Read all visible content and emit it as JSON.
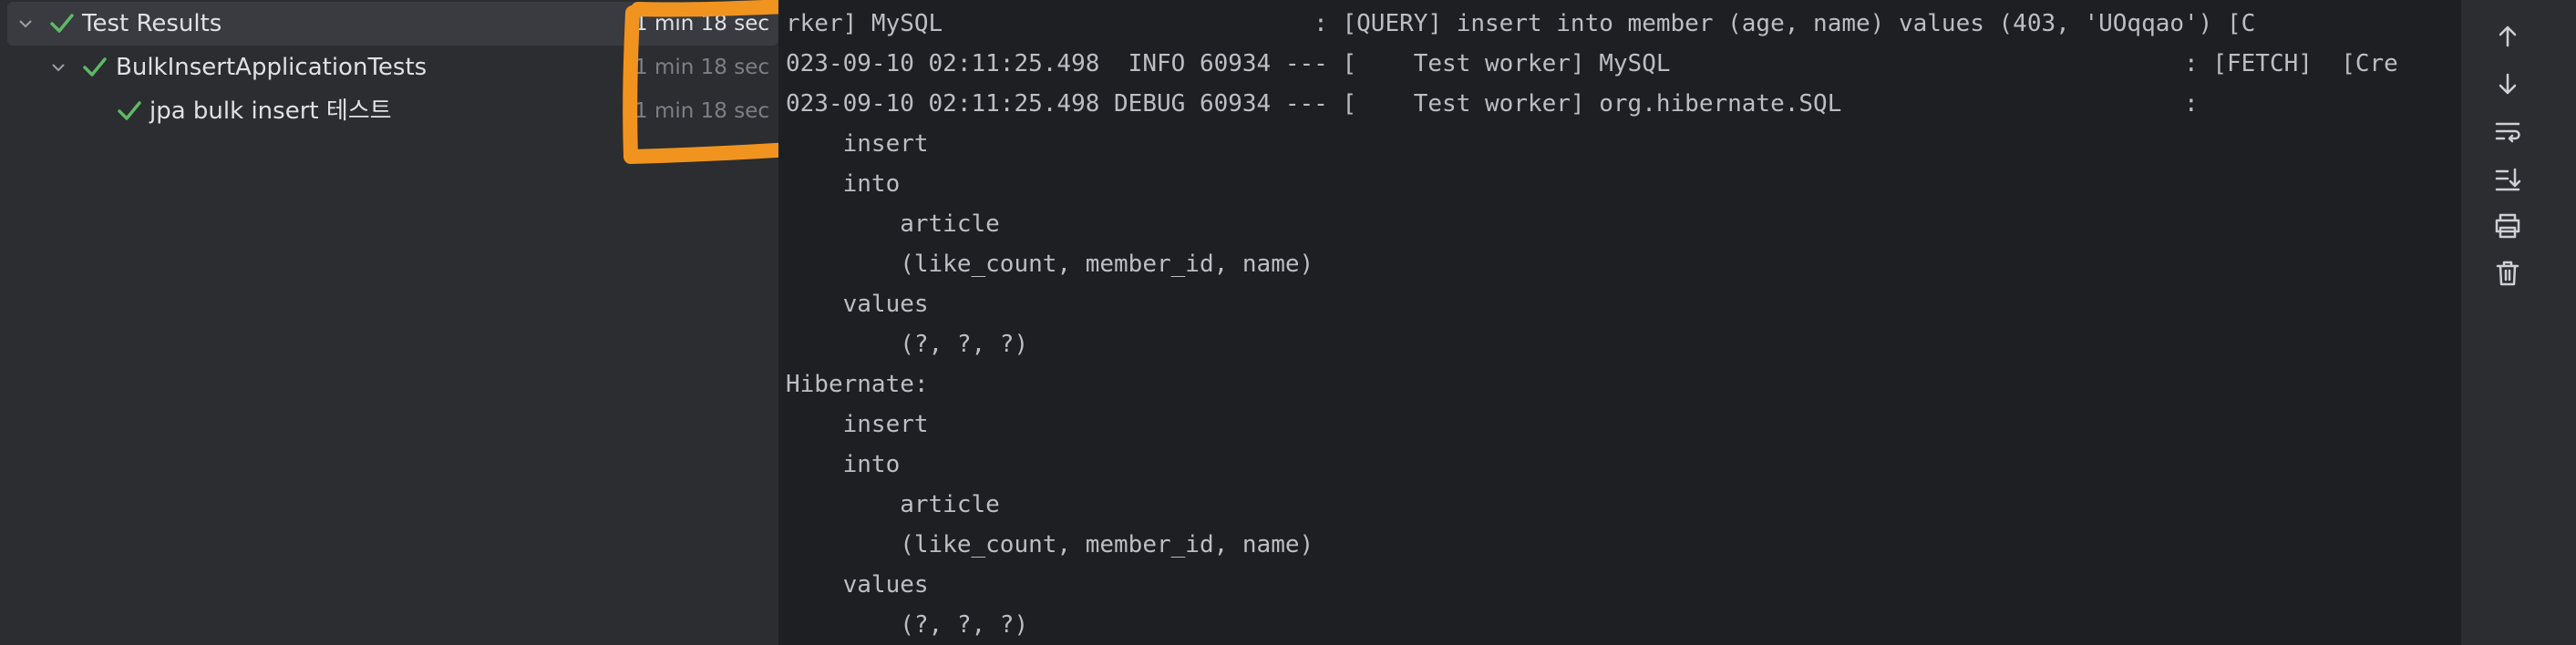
{
  "test_tree": {
    "root": {
      "label": "Test Results",
      "duration": "1 min 18 sec"
    },
    "suite": {
      "label": "BulkInsertApplicationTests",
      "duration": "1 min 18 sec"
    },
    "test": {
      "label": "jpa bulk insert 테스트",
      "duration": "1 min 18 sec"
    }
  },
  "console": {
    "lines": [
      "rker] MySQL                          : [QUERY] insert into member (age, name) values (403, 'UOqqao') [C",
      "023-09-10 02:11:25.498  INFO 60934 --- [    Test worker] MySQL                                    : [FETCH]  [Cre",
      "023-09-10 02:11:25.498 DEBUG 60934 --- [    Test worker] org.hibernate.SQL                        :",
      "    insert",
      "    into",
      "        article",
      "        (like_count, member_id, name)",
      "    values",
      "        (?, ?, ?)",
      "Hibernate:",
      "    insert",
      "    into",
      "        article",
      "        (like_count, member_id, name)",
      "    values",
      "        (?, ?, ?)"
    ]
  },
  "toolbar": {
    "icons": [
      "arrow-up-icon",
      "arrow-down-icon",
      "soft-wrap-icon",
      "scroll-to-end-icon",
      "print-icon",
      "trash-icon"
    ]
  },
  "colors": {
    "pass_green": "#5fb865",
    "annotation_orange": "#f0941f",
    "console_bg": "#1e1f22",
    "panel_bg": "#2b2d30"
  }
}
